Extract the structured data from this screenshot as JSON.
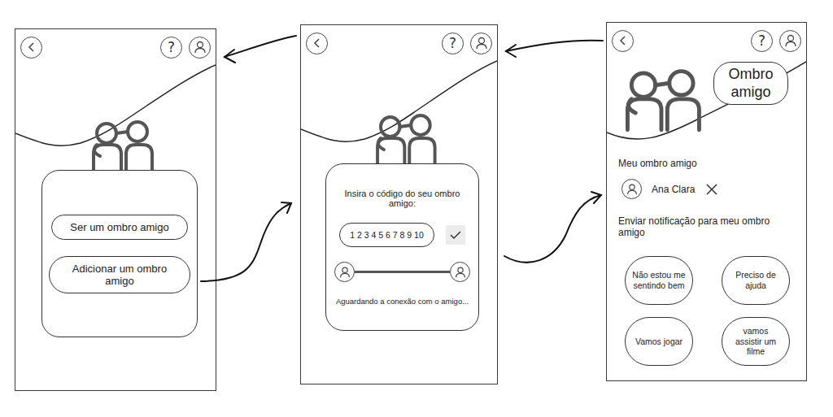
{
  "screens": [
    {
      "kind": "menu",
      "help": "?",
      "buttons": [
        "Ser um ombro amigo",
        "Adicionar um ombro amigo"
      ]
    },
    {
      "kind": "connect",
      "help": "?",
      "prompt": "Insira o código do seu ombro amigo:",
      "code": "1 2 3 4 5 6 7 8 9 10",
      "status": "Aguardando a conexão com o amigo..."
    },
    {
      "kind": "friend",
      "help": "?",
      "bubble": "Ombro amigo",
      "section": "Meu ombro amigo",
      "friend": "Ana Clara",
      "notify_label": "Enviar notificação para meu ombro amigo",
      "notifications": [
        "Não estou me sentindo bem",
        "Preciso de ajuda",
        "Vamos jogar",
        "vamos assistir um filme"
      ]
    }
  ]
}
